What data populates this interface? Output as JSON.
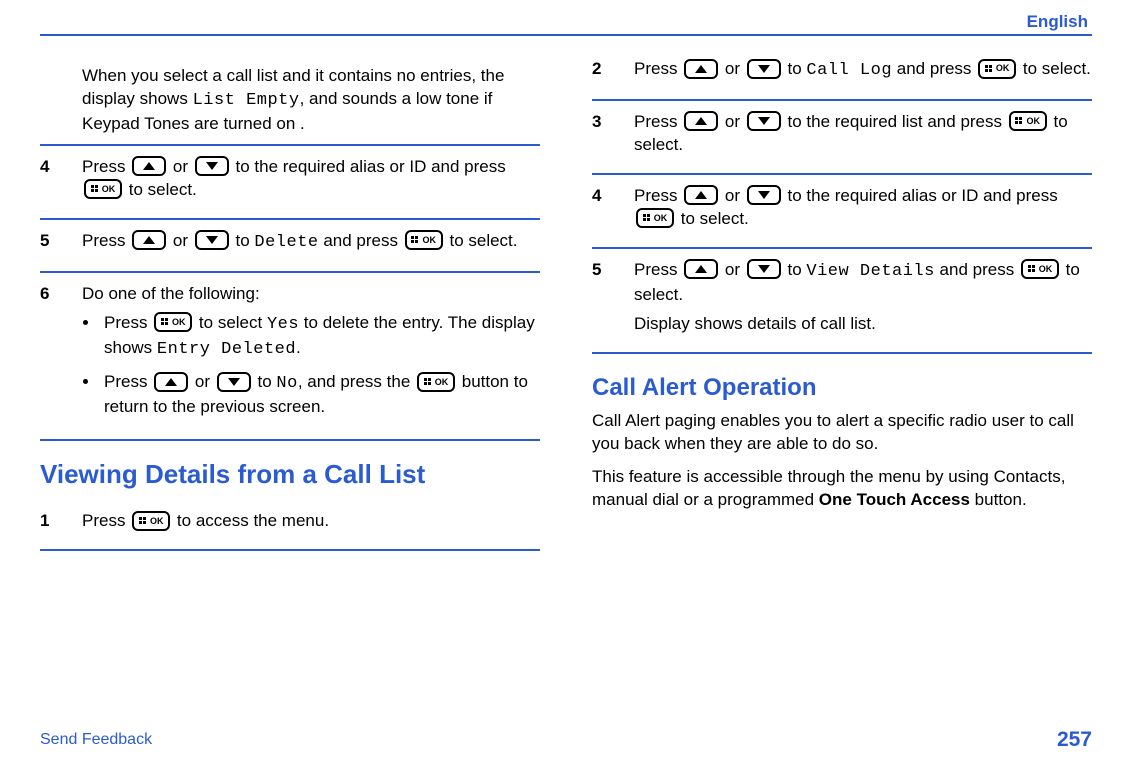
{
  "header": {
    "language": "English"
  },
  "left": {
    "intro_before_mono": "When you select a call list and it contains no entries, the display shows ",
    "intro_mono": "List Empty",
    "intro_after_mono": ", and sounds a low tone if Keypad Tones are turned on .",
    "step4": {
      "num": "4",
      "p1a": "Press ",
      "p1b": " or ",
      "p1c": " to the required alias or ID and press ",
      "p1d": " to select."
    },
    "step5": {
      "num": "5",
      "p1a": "Press ",
      "p1b": " or ",
      "p1c": " to ",
      "mono": "Delete",
      "p1d": " and press ",
      "p1e": " to select."
    },
    "step6": {
      "num": "6",
      "intro": "Do one of the following:",
      "b1a": "Press ",
      "b1b": " to select ",
      "b1_mono1": "Yes",
      "b1c": " to delete the entry. The display shows ",
      "b1_mono2": "Entry Deleted",
      "b1d": ".",
      "b2a": "Press ",
      "b2b": " or ",
      "b2c": " to ",
      "b2_mono": "No",
      "b2d": ", and press the ",
      "b2e": " button to return to the previous screen."
    },
    "heading": "Viewing Details from a Call List",
    "step1": {
      "num": "1",
      "p1a": "Press ",
      "p1b": " to access the menu."
    }
  },
  "right": {
    "step2": {
      "num": "2",
      "p1a": "Press ",
      "p1b": " or ",
      "p1c": " to ",
      "mono": "Call Log",
      "p1d": " and press ",
      "p1e": " to select."
    },
    "step3": {
      "num": "3",
      "p1a": "Press ",
      "p1b": " or ",
      "p1c": " to the required list and press ",
      "p1d": " to select."
    },
    "step4": {
      "num": "4",
      "p1a": "Press ",
      "p1b": " or ",
      "p1c": " to the required alias or ID and press ",
      "p1d": " to select."
    },
    "step5": {
      "num": "5",
      "p1a": "Press ",
      "p1b": " or ",
      "p1c": " to ",
      "mono": "View Details",
      "p1d": " and press ",
      "p1e": " to select.",
      "p2": "Display shows details of call list."
    },
    "heading": "Call Alert Operation",
    "para1": "Call Alert paging enables you to alert a specific radio user to call you back when they are able to do so.",
    "para2a": "This feature is accessible through the menu by using Contacts, manual dial or a programmed ",
    "para2_bold": "One Touch Access",
    "para2b": " button."
  },
  "footer": {
    "feedback": "Send Feedback",
    "page": "257"
  },
  "icons": {
    "ok_label": "OK"
  }
}
